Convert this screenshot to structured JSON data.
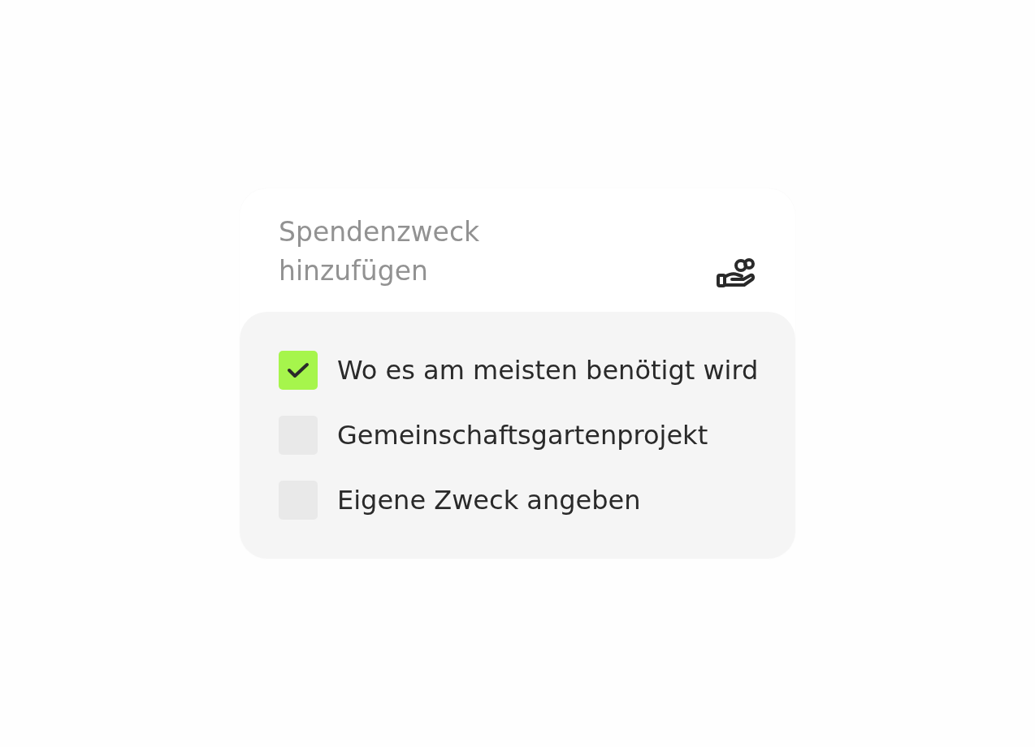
{
  "header": {
    "title": "Spendenzweck hinzufügen"
  },
  "options": [
    {
      "label": "Wo es am meisten benötigt wird",
      "checked": true
    },
    {
      "label": "Gemeinschaftsgartenprojekt",
      "checked": false
    },
    {
      "label": "Eigene Zweck angeben",
      "checked": false
    }
  ]
}
